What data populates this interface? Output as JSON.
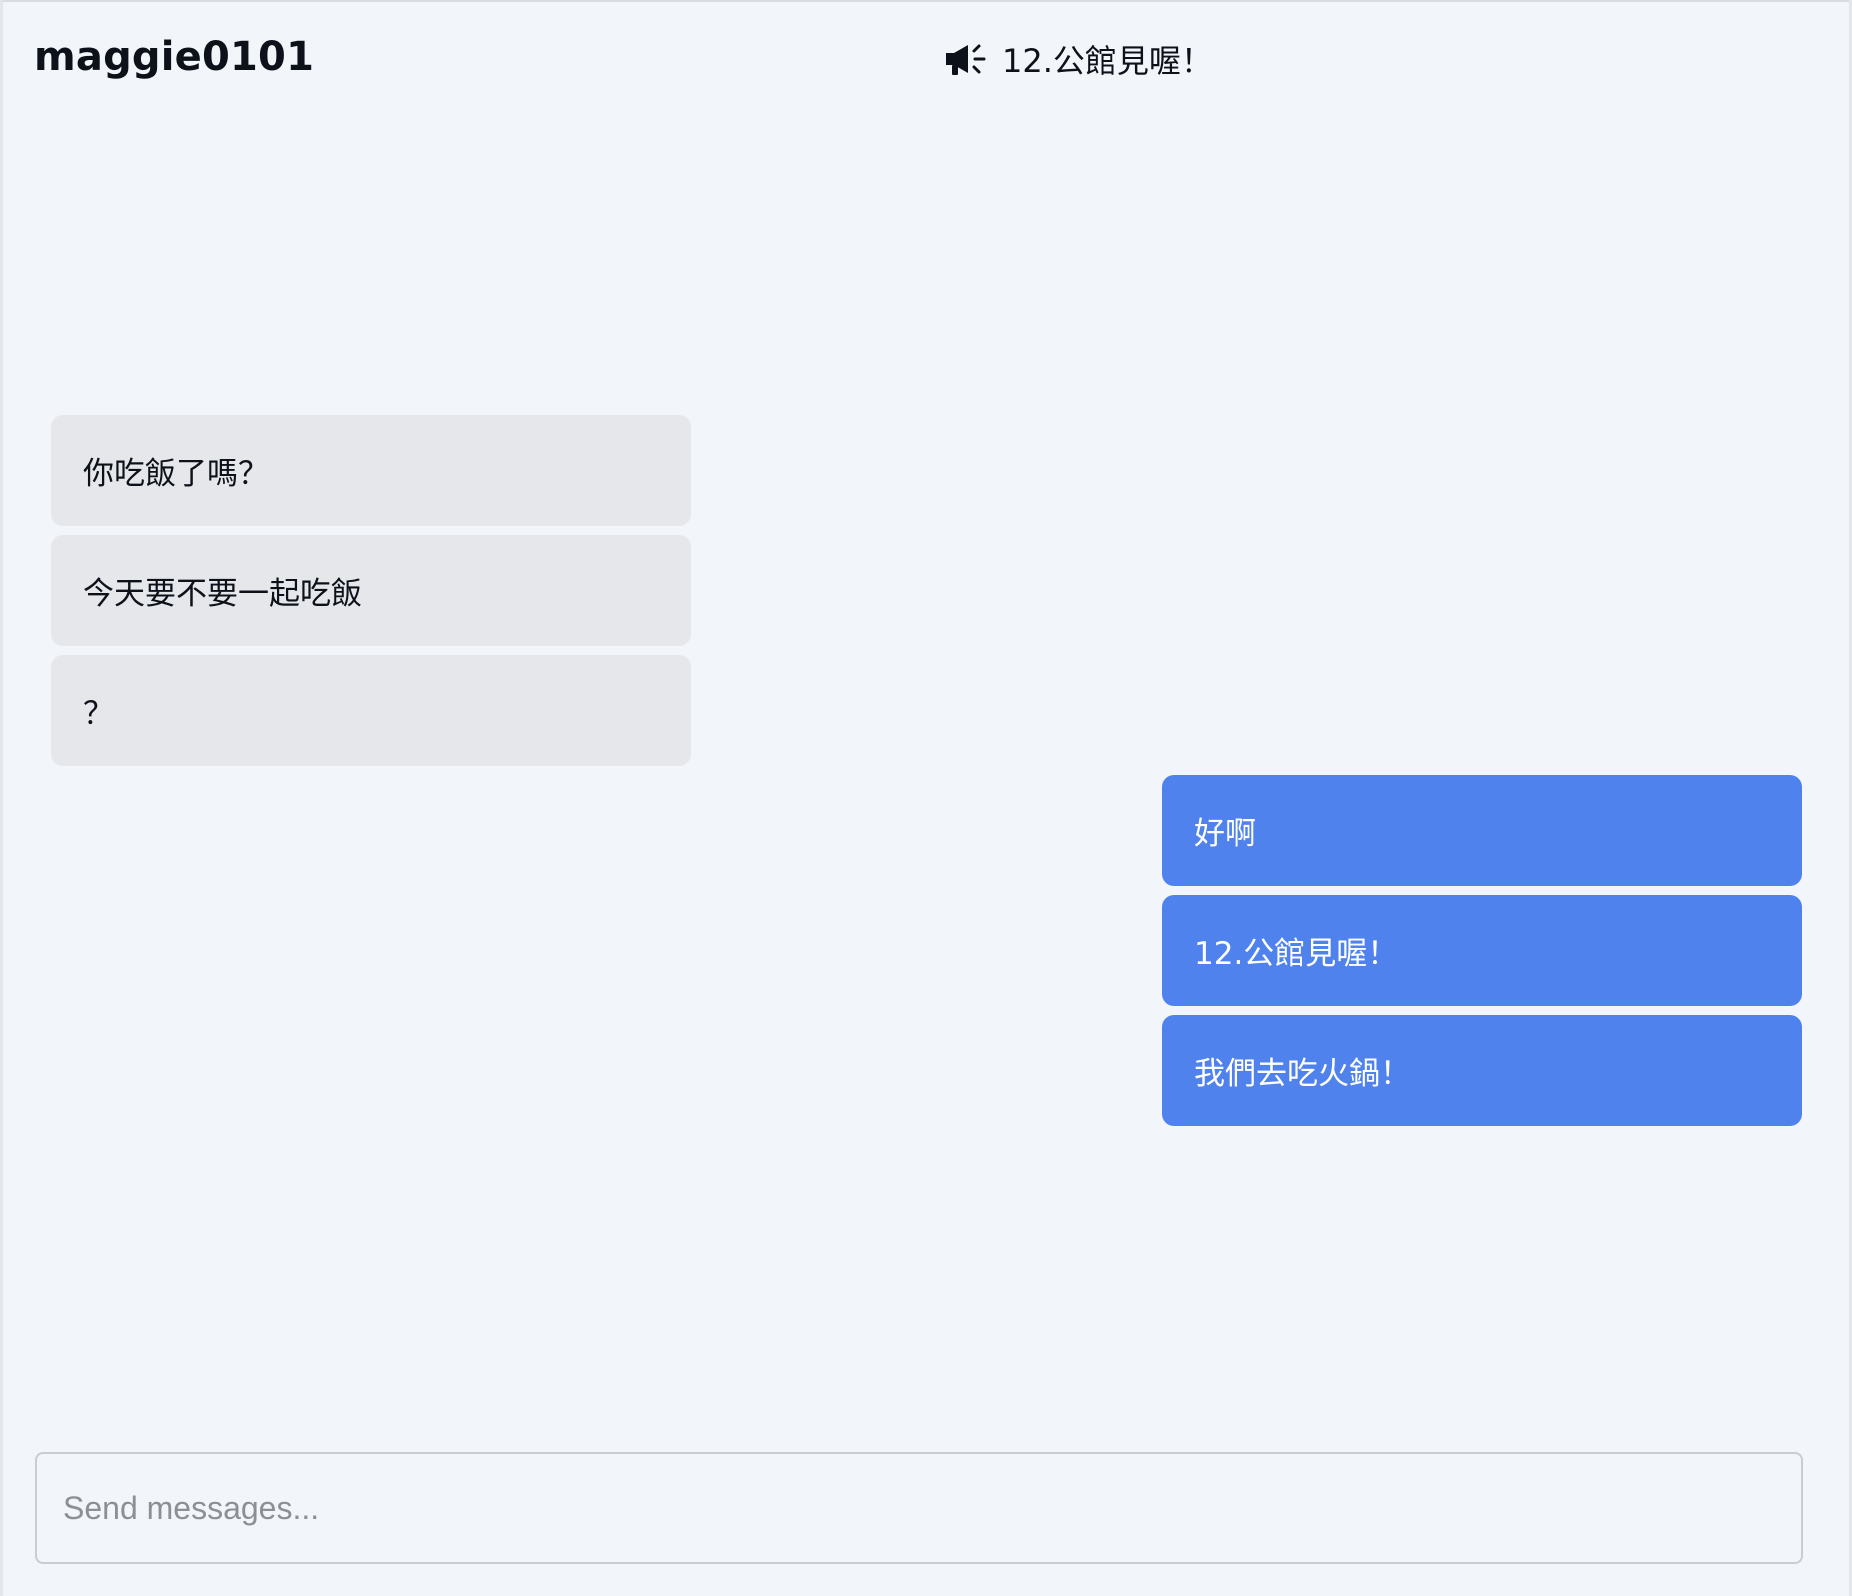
{
  "header": {
    "username": "maggie0101",
    "announcement": {
      "icon": "megaphone-icon",
      "text": "12.公館見喔！"
    }
  },
  "messages": {
    "incoming": [
      {
        "text": "你吃飯了嗎？"
      },
      {
        "text": "今天要不要一起吃飯"
      },
      {
        "text": "？"
      }
    ],
    "outgoing": [
      {
        "text": "好啊"
      },
      {
        "text": "12.公館見喔！"
      },
      {
        "text": "我們去吃火鍋！"
      }
    ]
  },
  "composer": {
    "placeholder": "Send messages...",
    "value": ""
  },
  "colors": {
    "background": "#f2f5f9",
    "incoming_bubble": "#e5e7eb",
    "outgoing_bubble": "#4f82ed",
    "text": "#0d111a",
    "placeholder": "#8b8f96"
  }
}
